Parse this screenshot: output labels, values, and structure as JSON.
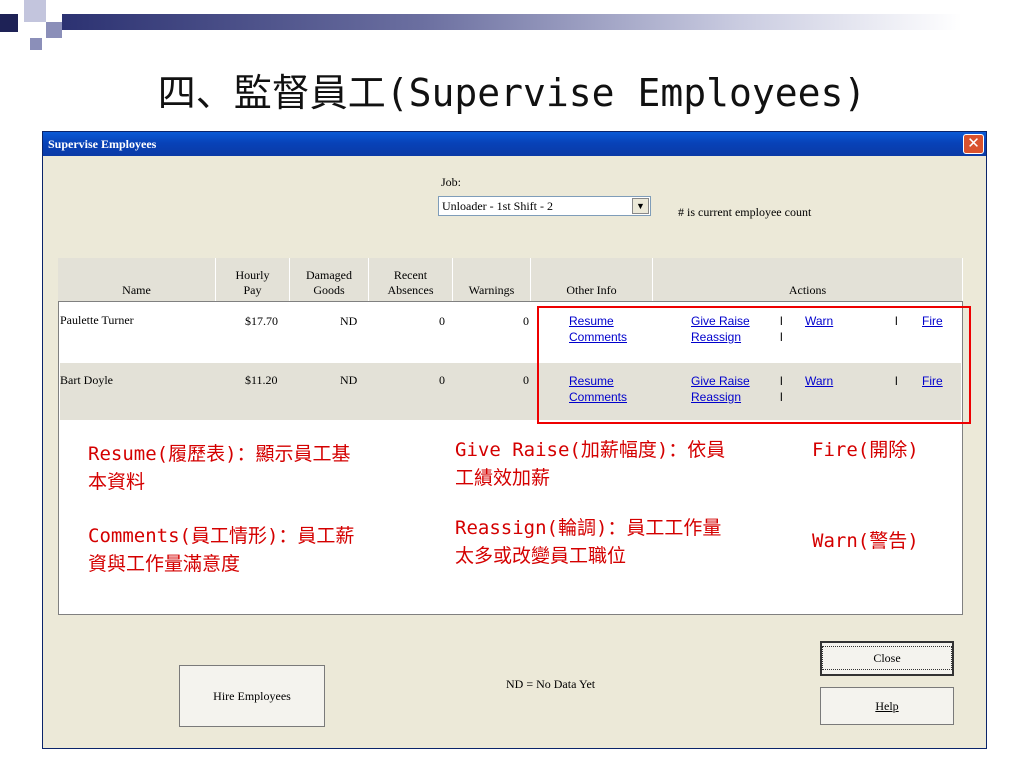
{
  "slide": {
    "title": "四、監督員工(Supervise Employees)"
  },
  "dialog": {
    "title": "Supervise Employees",
    "close_glyph": "✕",
    "job_label": "Job:",
    "job_value": "Unloader - 1st Shift - 2",
    "combo_arrow": "▼",
    "count_note": "# is current employee count",
    "columns": {
      "name": "Name",
      "hourly_pay": [
        "Hourly",
        "Pay"
      ],
      "damaged_goods": [
        "Damaged",
        "Goods"
      ],
      "recent_absences": [
        "Recent",
        "Absences"
      ],
      "warnings": "Warnings",
      "other_info": "Other Info",
      "actions": "Actions"
    },
    "rows": [
      {
        "name": "Paulette Turner",
        "pay": "$17.70",
        "damaged": "ND",
        "absences": "0",
        "warnings": "0"
      },
      {
        "name": "Bart Doyle",
        "pay": "$11.20",
        "damaged": "ND",
        "absences": "0",
        "warnings": "0"
      }
    ],
    "links": {
      "resume": "Resume",
      "comments": "Comments",
      "give_raise": "Give Raise",
      "reassign": "Reassign",
      "warn": "Warn",
      "fire": "Fire",
      "separator": "l"
    },
    "footer_note": "ND = No Data Yet",
    "hire_button": "Hire Employees",
    "close_button": "Close",
    "help_button": "Help"
  },
  "annotations": {
    "resume": [
      "Resume(履歷表)：顯示員工基",
      "本資料"
    ],
    "comments": [
      "Comments(員工情形)：員工薪",
      "資與工作量滿意度"
    ],
    "give_raise": [
      "Give Raise(加薪幅度)：依員",
      "工績效加薪"
    ],
    "reassign": [
      "Reassign(輪調)：員工工作量",
      "太多或改變員工職位"
    ],
    "fire": "Fire(開除)",
    "warn": "Warn(警告)"
  },
  "colors": {
    "titlebar": "#0a4ac6",
    "dialog_bg": "#ece9d8",
    "link": "#0000cc",
    "annotation": "#d40000",
    "highlight_box": "#ee0000",
    "slide_bar": "#2c3272"
  }
}
